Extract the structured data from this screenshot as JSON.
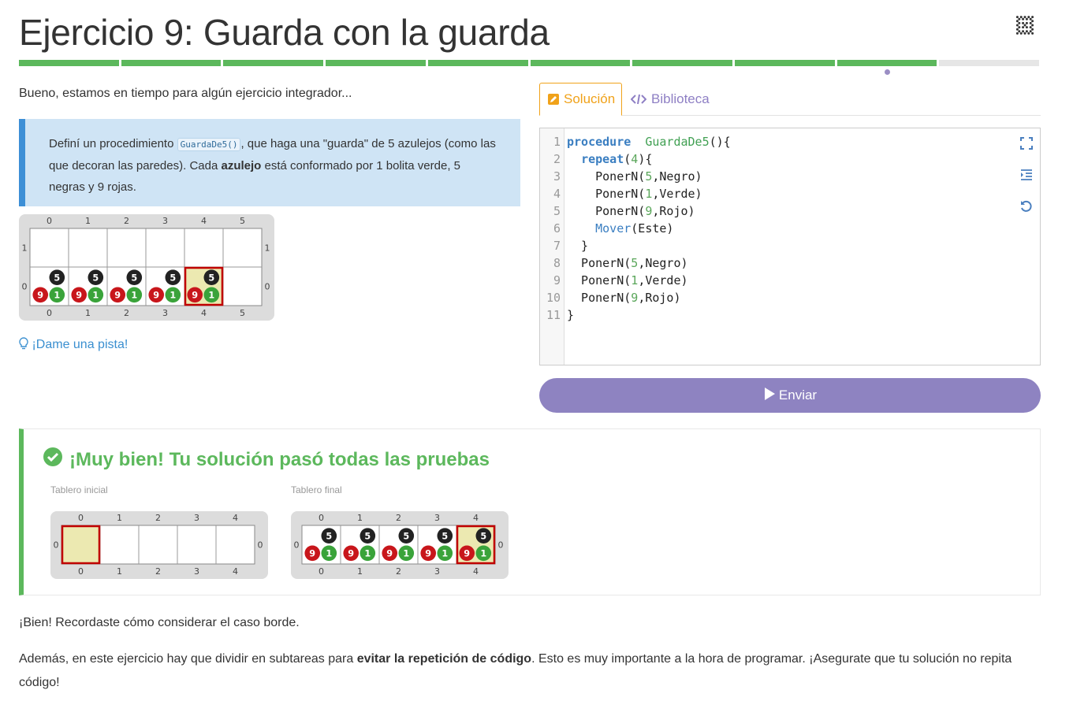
{
  "page": {
    "title": "Ejercicio 9: Guarda con la guarda",
    "logo_icon": "mumuki-diamond-logo-icon"
  },
  "progress": {
    "segments": [
      "done",
      "done",
      "done",
      "done",
      "done",
      "done",
      "done",
      "done",
      "done",
      "todo"
    ],
    "current_index": 8,
    "colors": {
      "done": "#5cb85c",
      "todo": "#e6e6e6",
      "marker": "#9b8ec4"
    }
  },
  "statement": {
    "intro": "Bueno, estamos en tiempo para algún ejercicio integrador...",
    "callout": {
      "t1": "Definí un procedimiento ",
      "code": "GuardaDe5()",
      "t2": ", que haga una \"guarda\" de 5 azulejos (como las que decoran las paredes). Cada ",
      "bold": "azulejo",
      "t3": " está conformado por 1 bolita verde, 5 negras y 9 rojas."
    },
    "hint": "¡Dame una pista!"
  },
  "boards": {
    "example": {
      "cols": [
        "0",
        "1",
        "2",
        "3",
        "4",
        "5"
      ],
      "rows": [
        "1",
        "0"
      ],
      "cells": [
        {
          "col": 0,
          "row": 0,
          "negro": "5",
          "rojo": "9",
          "verde": "1"
        },
        {
          "col": 1,
          "row": 0,
          "negro": "5",
          "rojo": "9",
          "verde": "1"
        },
        {
          "col": 2,
          "row": 0,
          "negro": "5",
          "rojo": "9",
          "verde": "1"
        },
        {
          "col": 3,
          "row": 0,
          "negro": "5",
          "rojo": "9",
          "verde": "1"
        },
        {
          "col": 4,
          "row": 0,
          "negro": "5",
          "rojo": "9",
          "verde": "1"
        }
      ],
      "head": {
        "col": 4,
        "row": 0
      }
    },
    "initial": {
      "label": "Tablero inicial",
      "cols": [
        "0",
        "1",
        "2",
        "3",
        "4"
      ],
      "rows": [
        "0"
      ],
      "cells": [],
      "head": {
        "col": 0,
        "row": 0
      }
    },
    "final": {
      "label": "Tablero final",
      "cols": [
        "0",
        "1",
        "2",
        "3",
        "4"
      ],
      "rows": [
        "0"
      ],
      "cells": [
        {
          "col": 0,
          "row": 0,
          "negro": "5",
          "rojo": "9",
          "verde": "1"
        },
        {
          "col": 1,
          "row": 0,
          "negro": "5",
          "rojo": "9",
          "verde": "1"
        },
        {
          "col": 2,
          "row": 0,
          "negro": "5",
          "rojo": "9",
          "verde": "1"
        },
        {
          "col": 3,
          "row": 0,
          "negro": "5",
          "rojo": "9",
          "verde": "1"
        },
        {
          "col": 4,
          "row": 0,
          "negro": "5",
          "rojo": "9",
          "verde": "1"
        }
      ],
      "head": {
        "col": 4,
        "row": 0
      }
    }
  },
  "editor": {
    "tabs": {
      "solution": "Solución",
      "library": "Biblioteca"
    },
    "lines": [
      [
        [
          "kw",
          "procedure"
        ],
        [
          "",
          "  "
        ],
        [
          "fn",
          "GuardaDe5"
        ],
        [
          "",
          "(){"
        ]
      ],
      [
        [
          "",
          "  "
        ],
        [
          "kw",
          "repeat"
        ],
        [
          "",
          "("
        ],
        [
          "num",
          "4"
        ],
        [
          "",
          "){"
        ]
      ],
      [
        [
          "",
          "    PonerN("
        ],
        [
          "num",
          "5"
        ],
        [
          "",
          ",Negro)"
        ]
      ],
      [
        [
          "",
          "    PonerN("
        ],
        [
          "num",
          "1"
        ],
        [
          "",
          ",Verde)"
        ]
      ],
      [
        [
          "",
          "    PonerN("
        ],
        [
          "num",
          "9"
        ],
        [
          "",
          ",Rojo)"
        ]
      ],
      [
        [
          "",
          "    "
        ],
        [
          "cmd",
          "Mover"
        ],
        [
          "",
          "(Este)"
        ]
      ],
      [
        [
          "",
          "  }"
        ]
      ],
      [
        [
          "",
          "  PonerN("
        ],
        [
          "num",
          "5"
        ],
        [
          "",
          ",Negro)"
        ]
      ],
      [
        [
          "",
          "  PonerN("
        ],
        [
          "num",
          "1"
        ],
        [
          "",
          ",Verde)"
        ]
      ],
      [
        [
          "",
          "  PonerN("
        ],
        [
          "num",
          "9"
        ],
        [
          "",
          ",Rojo)"
        ]
      ],
      [
        [
          "",
          "}"
        ]
      ]
    ],
    "send_label": "Enviar"
  },
  "result": {
    "title": "¡Muy bien! Tu solución pasó todas las pruebas"
  },
  "feedback": {
    "p1": "¡Bien! Recordaste cómo considerar el caso borde.",
    "p2_a": "Además, en este ejercicio hay que dividir en subtareas para ",
    "p2_bold": "evitar la repetición de código",
    "p2_b": ". Esto es muy importante a la hora de programar. ¡Asegurate que tu solución no repita código!"
  },
  "colors": {
    "accent_orange": "#f0a21a",
    "accent_purple": "#8e83c1",
    "success": "#5cb85c",
    "callout_bg": "#cfe4f5",
    "ball_red": "#c8161b",
    "ball_green": "#3aa33a",
    "ball_black": "#222222",
    "head_fill": "#ece9b1",
    "head_border": "#c00000"
  }
}
